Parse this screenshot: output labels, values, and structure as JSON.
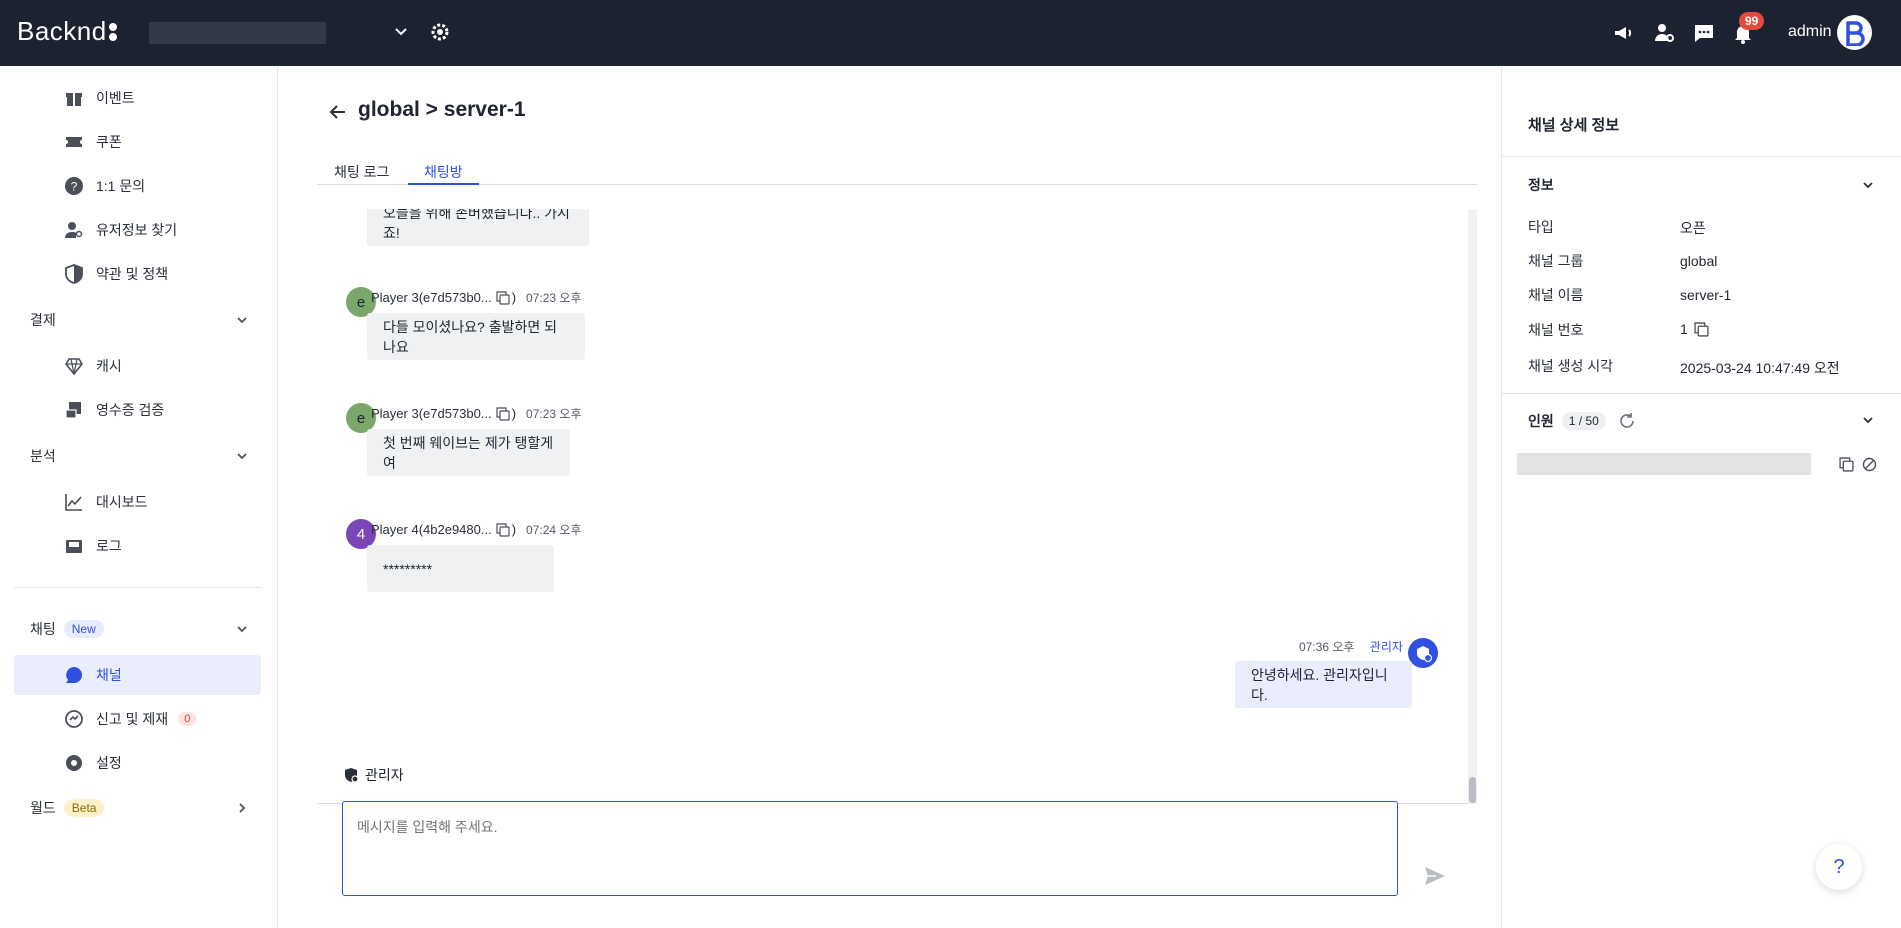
{
  "app": {
    "brand": "Backnd",
    "admin_name": "admin",
    "notification_count": "99"
  },
  "sidebar": {
    "items": [
      {
        "label": "이벤트",
        "icon": "gift-icon"
      },
      {
        "label": "쿠폰",
        "icon": "ticket-icon"
      },
      {
        "label": "1:1 문의",
        "icon": "question-icon"
      },
      {
        "label": "유저정보 찾기",
        "icon": "user-search-icon"
      },
      {
        "label": "약관 및 정책",
        "icon": "shield-icon"
      }
    ],
    "group_payment": "결제",
    "payment_items": [
      {
        "label": "캐시",
        "icon": "gem-icon"
      },
      {
        "label": "영수증 검증",
        "icon": "receipt-icon"
      }
    ],
    "group_analytics": "분석",
    "analytics_items": [
      {
        "label": "대시보드",
        "icon": "chart-icon"
      },
      {
        "label": "로그",
        "icon": "inbox-icon"
      }
    ],
    "group_chat": "채팅",
    "chat_tag": "New",
    "chat_items": [
      {
        "label": "채널",
        "icon": "chat-bubble-icon"
      },
      {
        "label": "신고 및 제재",
        "icon": "report-icon",
        "badge": "0"
      },
      {
        "label": "설정",
        "icon": "settings-icon"
      }
    ],
    "group_world": "월드",
    "world_tag": "Beta"
  },
  "main": {
    "title": "global > server-1",
    "tabs": [
      "채팅 로그",
      "채팅방"
    ],
    "messages": [
      {
        "text": "오늘을 위해 존버했습니다.. 가시죠!"
      },
      {
        "avatar": "e",
        "name": "Player 3(e7d573b0...",
        "close": ")",
        "time": "07:23 오후",
        "text": "다들 모이셨나요? 출발하면 되나요"
      },
      {
        "avatar": "e",
        "name": "Player 3(e7d573b0...",
        "close": ")",
        "time": "07:23 오후",
        "text": "첫 번째 웨이브는 제가 탱할게여"
      },
      {
        "avatar": "4",
        "name": "Player 4(4b2e9480...",
        "close": ")",
        "time": "07:24 오후",
        "text": "*********"
      }
    ],
    "admin_message": {
      "time": "07:36 오후",
      "role": "관리자",
      "text": "안녕하세요. 관리자입니다."
    },
    "composer_label": "관리자",
    "composer_placeholder": "메시지를 입력해 주세요."
  },
  "details": {
    "title": "채널 상세 정보",
    "info_section": "정보",
    "rows": [
      {
        "key": "타입",
        "value": "오픈"
      },
      {
        "key": "채널 그룹",
        "value": "global"
      },
      {
        "key": "채널 이름",
        "value": "server-1"
      },
      {
        "key": "채널 번호",
        "value": "1"
      },
      {
        "key": "채널 생성 시각",
        "value": "2025-03-24 10:47:49 오전"
      }
    ],
    "members_section": "인원",
    "members_count": "1 / 50",
    "help": "?"
  }
}
